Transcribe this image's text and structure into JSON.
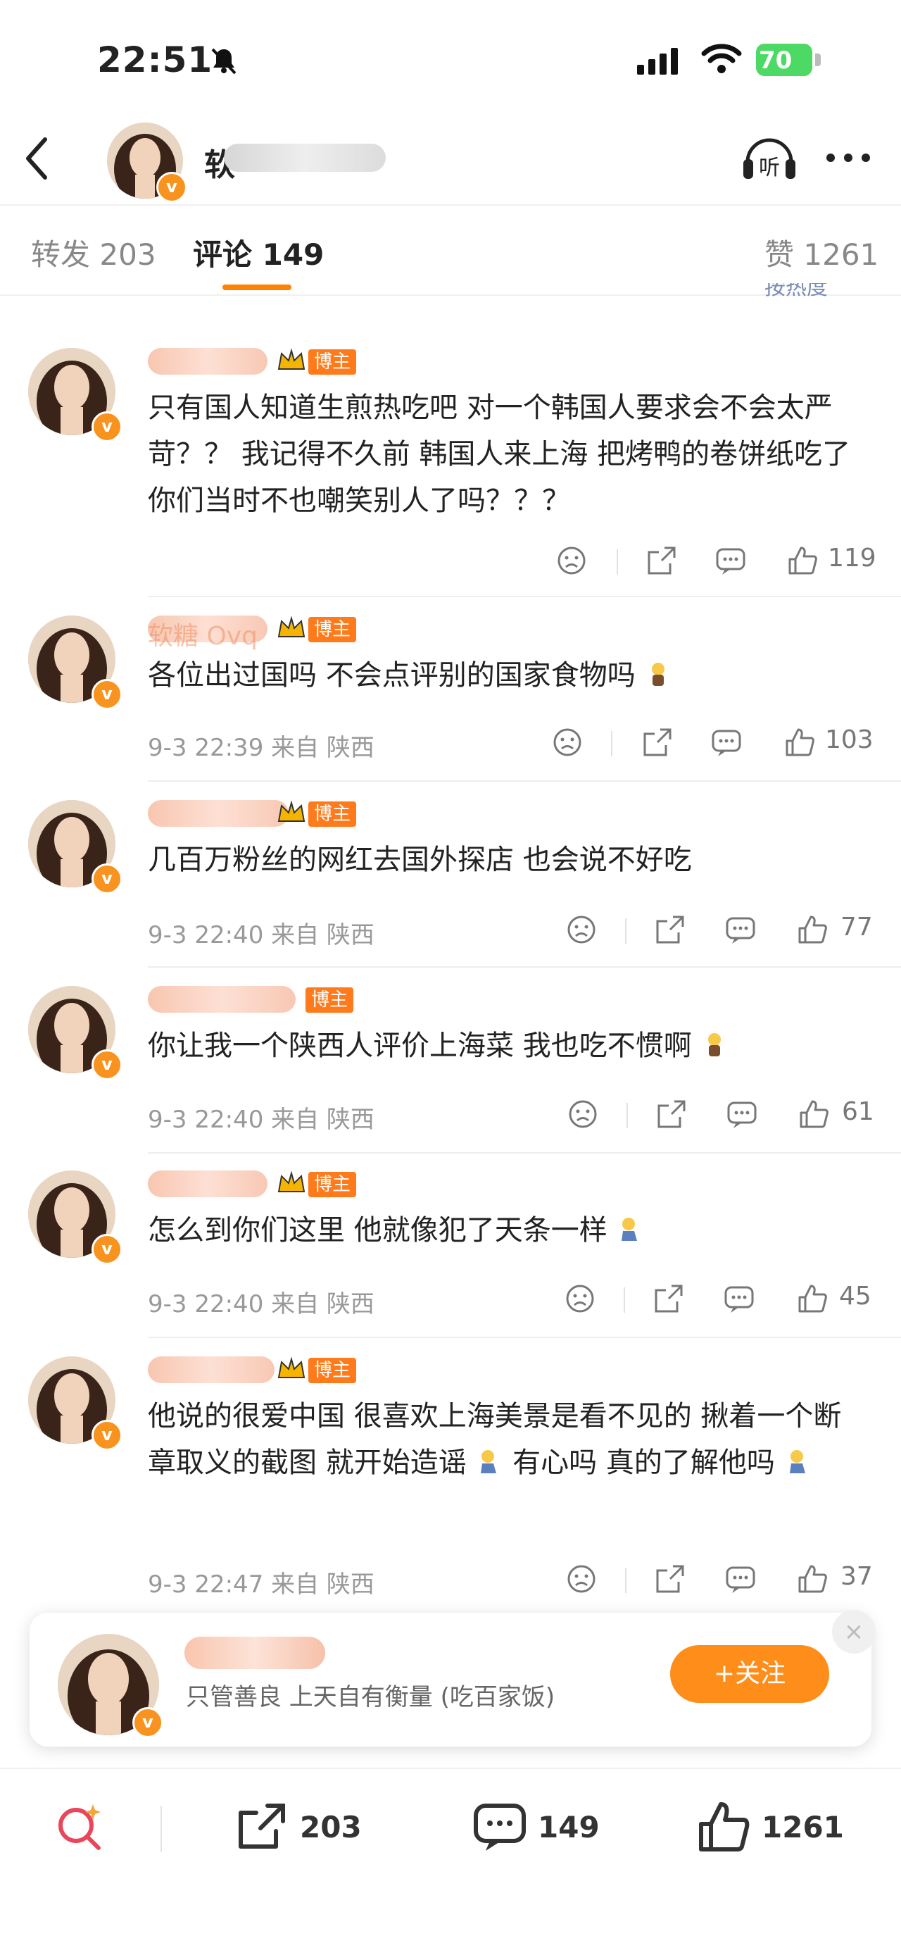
{
  "status": {
    "time": "22:51",
    "battery": "70"
  },
  "header": {
    "name_visible": "软",
    "listen_label": "听"
  },
  "tabs": {
    "repost_label": "转发",
    "repost_count": "203",
    "comment_label": "评论",
    "comment_count": "149",
    "like_label": "赞",
    "like_count": "1261",
    "hot_sort_label": "按热度"
  },
  "badge_label": "博主",
  "comments": [
    {
      "text": "只有国人知道生煎热吃吧 对一个韩国人要求会不会太严苛？？ 我记得不久前 韩国人来上海 把烤鸭的卷饼纸吃了 你们当时不也嘲笑别人了吗？？？",
      "meta": "",
      "likes": "119"
    },
    {
      "name": "软糖 Ovq",
      "text": "各位出过国吗 不会点评别的国家食物吗",
      "meta": "9-3 22:39 来自 陕西",
      "likes": "103"
    },
    {
      "text": "几百万粉丝的网红去国外探店 也会说不好吃",
      "meta": "9-3 22:40 来自 陕西",
      "likes": "77"
    },
    {
      "text": "你让我一个陕西人评价上海菜 我也吃不惯啊",
      "meta": "9-3 22:40 来自 陕西",
      "likes": "61"
    },
    {
      "text": "怎么到你们这里 他就像犯了天条一样",
      "meta": "9-3 22:40 来自 陕西",
      "likes": "45"
    },
    {
      "text_a": "他说的很爱中国 很喜欢上海美景是看不见的 揪着一个断章取义的截图 就开始造谣",
      "text_b": "有心吗 真的了解他吗",
      "meta": "9-3 22:47 来自 陕西",
      "likes": "37"
    }
  ],
  "popup": {
    "desc": "只管善良 上天自有衡量 (吃百家饭)",
    "follow_label": "+关注",
    "close_label": "×"
  },
  "bottom": {
    "repost_count": "203",
    "comment_count": "149",
    "like_count": "1261"
  }
}
